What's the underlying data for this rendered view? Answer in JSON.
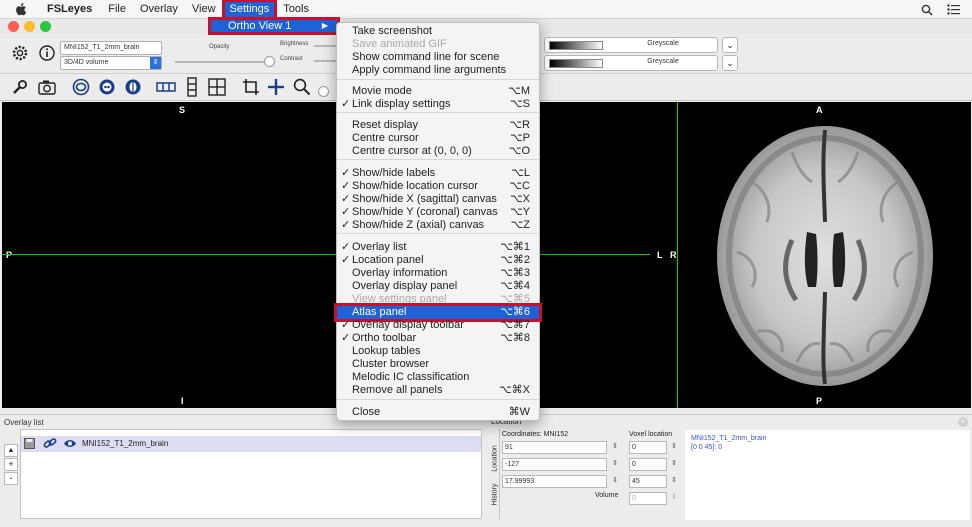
{
  "menubar": {
    "app_name": "FSLeyes",
    "items": [
      "File",
      "Overlay",
      "View",
      "Settings",
      "Tools"
    ]
  },
  "settings_submenu": {
    "label": "Ortho View 1",
    "arrow": "▶"
  },
  "ortho_menu": {
    "items": [
      {
        "check": "",
        "label": "Take screenshot",
        "shortcut": ""
      },
      {
        "check": "",
        "label": "Save animated GIF",
        "shortcut": ""
      },
      {
        "check": "",
        "label": "Show command line for scene",
        "shortcut": ""
      },
      {
        "check": "",
        "label": "Apply command line arguments",
        "shortcut": ""
      },
      {
        "check": "",
        "label": "Movie mode",
        "shortcut": "⌥M"
      },
      {
        "check": "✓",
        "label": "Link display settings",
        "shortcut": "⌥S"
      },
      {
        "check": "",
        "label": "Reset display",
        "shortcut": "⌥R"
      },
      {
        "check": "",
        "label": "Centre cursor",
        "shortcut": "⌥P"
      },
      {
        "check": "",
        "label": "Centre cursor at (0, 0, 0)",
        "shortcut": "⌥O"
      },
      {
        "check": "✓",
        "label": "Show/hide labels",
        "shortcut": "⌥L"
      },
      {
        "check": "✓",
        "label": "Show/hide location cursor",
        "shortcut": "⌥C"
      },
      {
        "check": "✓",
        "label": "Show/hide X (sagittal) canvas",
        "shortcut": "⌥X"
      },
      {
        "check": "✓",
        "label": "Show/hide Y (coronal) canvas",
        "shortcut": "⌥Y"
      },
      {
        "check": "✓",
        "label": "Show/hide Z (axial) canvas",
        "shortcut": "⌥Z"
      },
      {
        "check": "✓",
        "label": "Overlay list",
        "shortcut": "⌥⌘1"
      },
      {
        "check": "✓",
        "label": "Location panel",
        "shortcut": "⌥⌘2"
      },
      {
        "check": "",
        "label": "Overlay information",
        "shortcut": "⌥⌘3"
      },
      {
        "check": "",
        "label": "Overlay display panel",
        "shortcut": "⌥⌘4"
      },
      {
        "check": "",
        "label": "View settings panel",
        "shortcut": "⌥⌘5"
      },
      {
        "check": "",
        "label": "Atlas panel",
        "shortcut": "⌥⌘6"
      },
      {
        "check": "✓",
        "label": "Overlay display toolbar",
        "shortcut": "⌥⌘7"
      },
      {
        "check": "✓",
        "label": "Ortho toolbar",
        "shortcut": "⌥⌘8"
      },
      {
        "check": "",
        "label": "Lookup tables",
        "shortcut": ""
      },
      {
        "check": "",
        "label": "Cluster browser",
        "shortcut": ""
      },
      {
        "check": "",
        "label": "Melodic IC classification",
        "shortcut": ""
      },
      {
        "check": "",
        "label": "Remove all panels",
        "shortcut": "⌥⌘X"
      },
      {
        "check": "",
        "label": "Close",
        "shortcut": "⌘W"
      }
    ]
  },
  "overlay_toolbar": {
    "overlay_name": "MNI152_T1_2mm_brain",
    "overlay_type": "3D/4D volume",
    "opacity_label": "Opacity",
    "brightness_label": "Brightness",
    "contrast_label": "Contrast",
    "cmap1": "Greyscale",
    "cmap2": "Greyscale"
  },
  "canvas": {
    "sagittal": {
      "top": "S",
      "left": "P",
      "bottom": "I"
    },
    "coronal": {
      "left": "L",
      "right": "R"
    },
    "axial": {
      "top": "A",
      "bottom": "P"
    }
  },
  "overlay_list": {
    "title": "Overlay list",
    "item": "MNI152_T1_2mm_brain"
  },
  "location": {
    "title": "Location",
    "coordinates_label": "Coordinates: MNI152",
    "voxel_label": "Voxel location",
    "tab_label": "Location",
    "history_label": "History",
    "world": [
      "91",
      "-127",
      "17.99993"
    ],
    "voxel": [
      "0",
      "0",
      "45"
    ],
    "volume_label": "Volume",
    "volume_value": "0",
    "info_name": "MNI152_T1_2mm_brain",
    "info_value": "[0 0 45]: 0"
  }
}
